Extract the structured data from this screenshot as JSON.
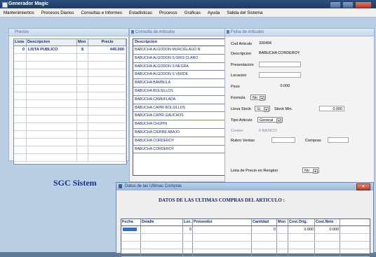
{
  "window": {
    "title": "Generador Magic"
  },
  "menu": [
    "Mantenimientos",
    "Procesos Diarios",
    "Consultas e Informes",
    "Estadisticas",
    "Procesos",
    "Graficas",
    "Ayuda",
    "Salida del Sistema"
  ],
  "prices_panel": {
    "title": "Precios",
    "headers": [
      "Lista",
      "Descripcion",
      "Mon",
      "Precio"
    ],
    "rows": [
      [
        "0",
        "LISTA PUBLICO",
        "$",
        "445.000"
      ]
    ]
  },
  "articles_panel": {
    "title": "Consulta de Articulos",
    "header": "Descripcion",
    "items": [
      "BABUCHA ALGODON MURCIELAGO N",
      "BABUCHA ALGODON S GRIS CLARO",
      "BABUCHA ALGODON S NEGRA",
      "BABUCHA ALGODON S VERDE",
      "BABUCHA BAMBULA",
      "BABUCHA BOLSILLOS",
      "BABUCHA CAMUFLADA",
      "BABUCHA CAPRI BOLSILLOS",
      "BABUCHA CAPRI GAUCHOS",
      "BABUCHA CHUPIN",
      "BABUCHA CIERRE ABAJO",
      "BABUCHA CORDEROY",
      "BABUCHA CORDEROY"
    ]
  },
  "article_form": {
    "title": "Ficha de Articulos",
    "cod_label": "Cod Articulo",
    "cod_value": "330494",
    "desc_label": "Descripcion",
    "desc_value": "BABUCHA CORDEROY",
    "presentacion_label": "Presentacion",
    "locacion_label": "Locacion",
    "peso_label": "Peso",
    "peso_value": "0.000",
    "formula_label": "Formula",
    "formula_value": "No",
    "lleva_stock_label": "Lleva Stock",
    "lleva_stock_value": "Si",
    "stock_min_label": "Stock Min.",
    "stock_min_value": "0.000",
    "tipo_label": "Tipo Articulo",
    "tipo_value": "General",
    "costeo_label": "Costeo",
    "costeo_value": "0 BASICO",
    "rubro_label": "Rubro Ventas",
    "compras_label": "Compras",
    "lista_label": "Lista de Precio en Renglon",
    "lista_value": "No"
  },
  "sgc_text": "SGC Sistem",
  "dialog": {
    "title": "Datos de las Ultimas Compras",
    "heading": "DATOS DE LAS ULTIMAS COMPRAS DEL ARTICULO :",
    "headers": [
      "Fecha",
      "Detalle",
      "Loc.",
      "Proveedor",
      "Cantidad",
      "Mon",
      "Cost.Orig.",
      "Cost.Neto"
    ],
    "rows": [
      [
        "",
        "",
        "0",
        "",
        "0",
        "",
        "0.000",
        "0.000"
      ]
    ]
  }
}
